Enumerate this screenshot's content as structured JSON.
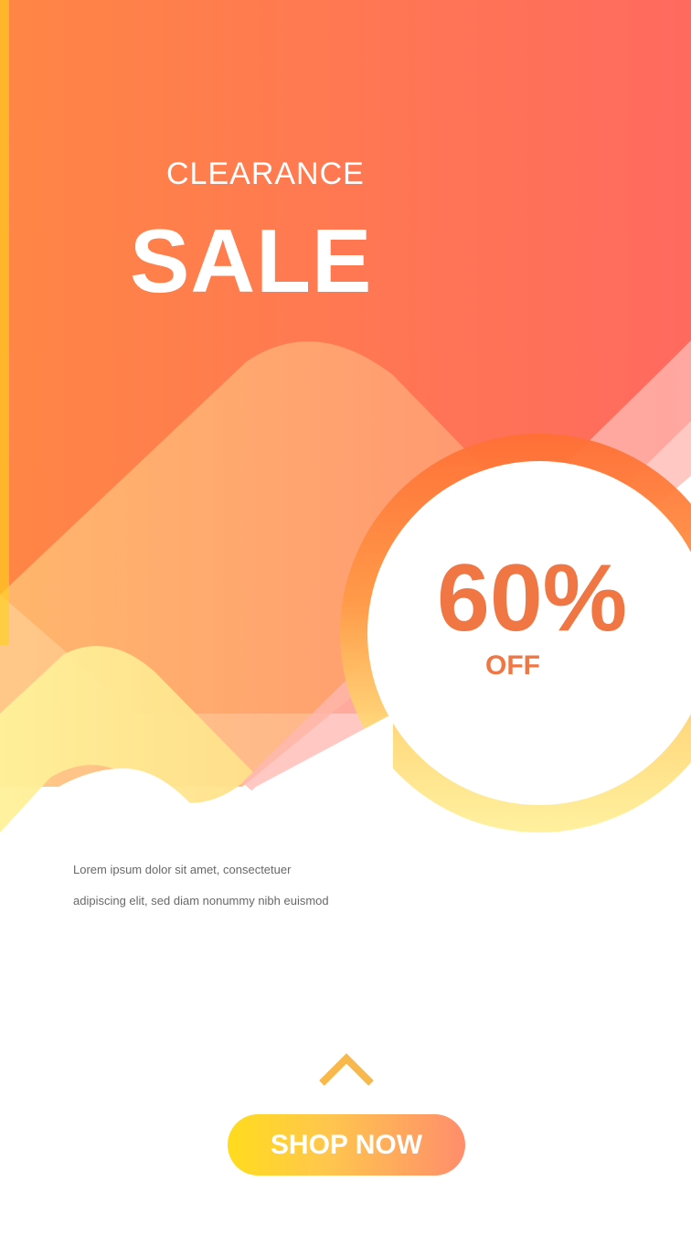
{
  "colors": {
    "orange": "#ff7f45",
    "coral": "#ff6a5f",
    "peach": "#ffad72",
    "yellow": "#fff19a",
    "pink": "#ffb9b2",
    "discount_text": "#f07644",
    "body_text": "#686868"
  },
  "banner": {
    "eyebrow": "CLEARANCE",
    "headline": "SALE"
  },
  "offer": {
    "amount": "60%",
    "suffix": "OFF"
  },
  "description": {
    "line1": "Lorem ipsum dolor sit amet, consectetuer",
    "line2": "adipiscing elit, sed diam nonummy nibh euismod"
  },
  "cta": {
    "icon": "chevron-up-icon",
    "label": "SHOP NOW"
  }
}
